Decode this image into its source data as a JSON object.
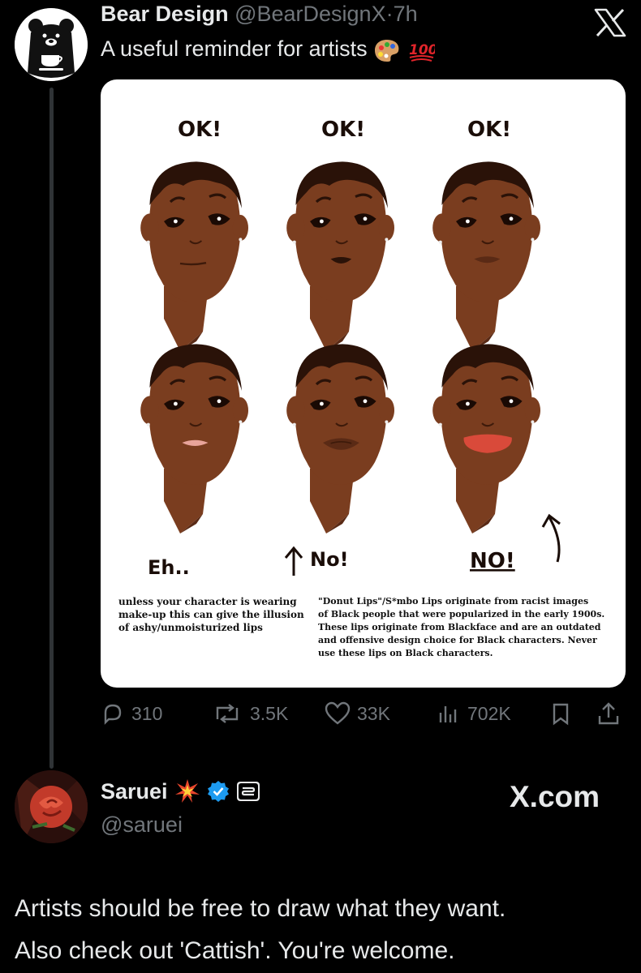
{
  "tweet": {
    "author_name": "Bear Design",
    "author_handle": "@BearDesignX",
    "separator": "·",
    "time_ago": "7h",
    "text": "A useful reminder for artists",
    "text_emojis": [
      "palette-emoji",
      "hundred-points-emoji"
    ]
  },
  "infographic": {
    "top_labels": [
      "OK!",
      "OK!",
      "OK!"
    ],
    "bottom_labels": [
      "Eh..",
      "No!",
      "NO!"
    ],
    "caption_left": [
      "unless your character is wearing",
      "make-up this can give the illusion",
      "of ashy/unmoisturized lips"
    ],
    "caption_right": [
      "\"Donut Lips\"/S*mbo Lips originate from racist images",
      "of Black people that were popularized in the early 1900s.",
      "These lips originate from Blackface and are an outdated",
      "and offensive design choice for Black characters. Never",
      "use these lips on Black characters."
    ],
    "colors": {
      "skin": "#7a3d1f",
      "hair": "#2a1208",
      "lip_pink": "#e8a49a",
      "lip_brown": "#5a2a15",
      "lip_red": "#d94a3a"
    }
  },
  "actions": {
    "replies": "310",
    "reposts": "3.5K",
    "likes": "33K",
    "views": "702K",
    "icons": [
      "reply-icon",
      "repost-icon",
      "like-icon",
      "views-icon",
      "bookmark-icon",
      "share-icon"
    ]
  },
  "reply": {
    "name": "Saruei",
    "handle": "@saruei",
    "badges": [
      "collision-emoji",
      "verified-badge-icon",
      "subscriber-badge-icon"
    ],
    "watermark": "X.com",
    "body_lines": [
      "Artists should be free to draw what they want.",
      "Also check out 'Cattish'. You're welcome."
    ]
  },
  "theme": {
    "background": "#000000",
    "text": "#e7e9ea",
    "muted": "#71767b",
    "verified_blue": "#1d9bf0"
  }
}
